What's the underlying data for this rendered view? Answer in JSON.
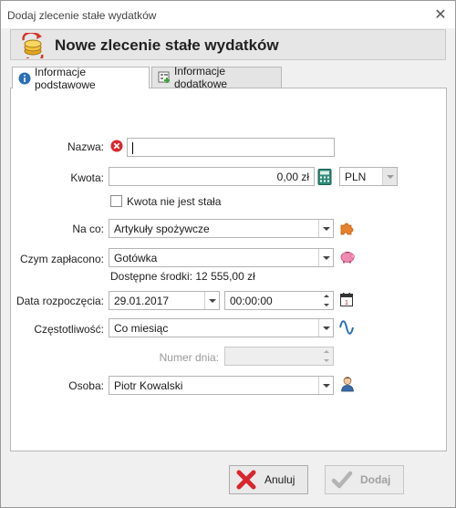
{
  "window": {
    "title": "Dodaj zlecenie stałe wydatków",
    "close_glyph": "✕"
  },
  "header": {
    "title": "Nowe zlecenie stałe wydatków",
    "icon": "coins-refresh-icon"
  },
  "tabs": [
    {
      "label": "Informacje podstawowe",
      "icon": "info-icon",
      "active": true
    },
    {
      "label": "Informacje dodatkowe",
      "icon": "form-add-icon",
      "active": false
    }
  ],
  "form": {
    "name": {
      "label": "Nazwa:",
      "value": "",
      "error_icon": "error-icon"
    },
    "amount": {
      "label": "Kwota:",
      "value": "0,00 zł",
      "currency": "PLN",
      "icon": "calculator-icon"
    },
    "variable_amount": {
      "label": "Kwota nie jest stała",
      "checked": false
    },
    "category": {
      "label": "Na co:",
      "value": "Artykuły spożywcze",
      "icon": "puzzle-icon"
    },
    "payment": {
      "label": "Czym zapłacono:",
      "value": "Gotówka",
      "icon": "piggy-bank-icon",
      "available": "Dostępne środki: 12 555,00 zł"
    },
    "start_date": {
      "label": "Data rozpoczęcia:",
      "date": "29.01.2017",
      "time": "00:00:00",
      "icon": "calendar-icon"
    },
    "frequency": {
      "label": "Częstotliwość:",
      "value": "Co miesiąc",
      "icon": "sine-wave-icon"
    },
    "day_number": {
      "label": "Numer dnia:",
      "value": ""
    },
    "person": {
      "label": "Osoba:",
      "value": "Piotr Kowalski",
      "icon": "user-icon"
    }
  },
  "buttons": {
    "cancel": {
      "label": "Anuluj",
      "icon": "cancel-x-icon"
    },
    "add": {
      "label": "Dodaj",
      "icon": "checkmark-icon",
      "disabled": true
    }
  },
  "colors": {
    "error": "#d9262c",
    "accent": "#2a6fb8",
    "puzzle": "#e8822a",
    "pig": "#f08ab0"
  }
}
